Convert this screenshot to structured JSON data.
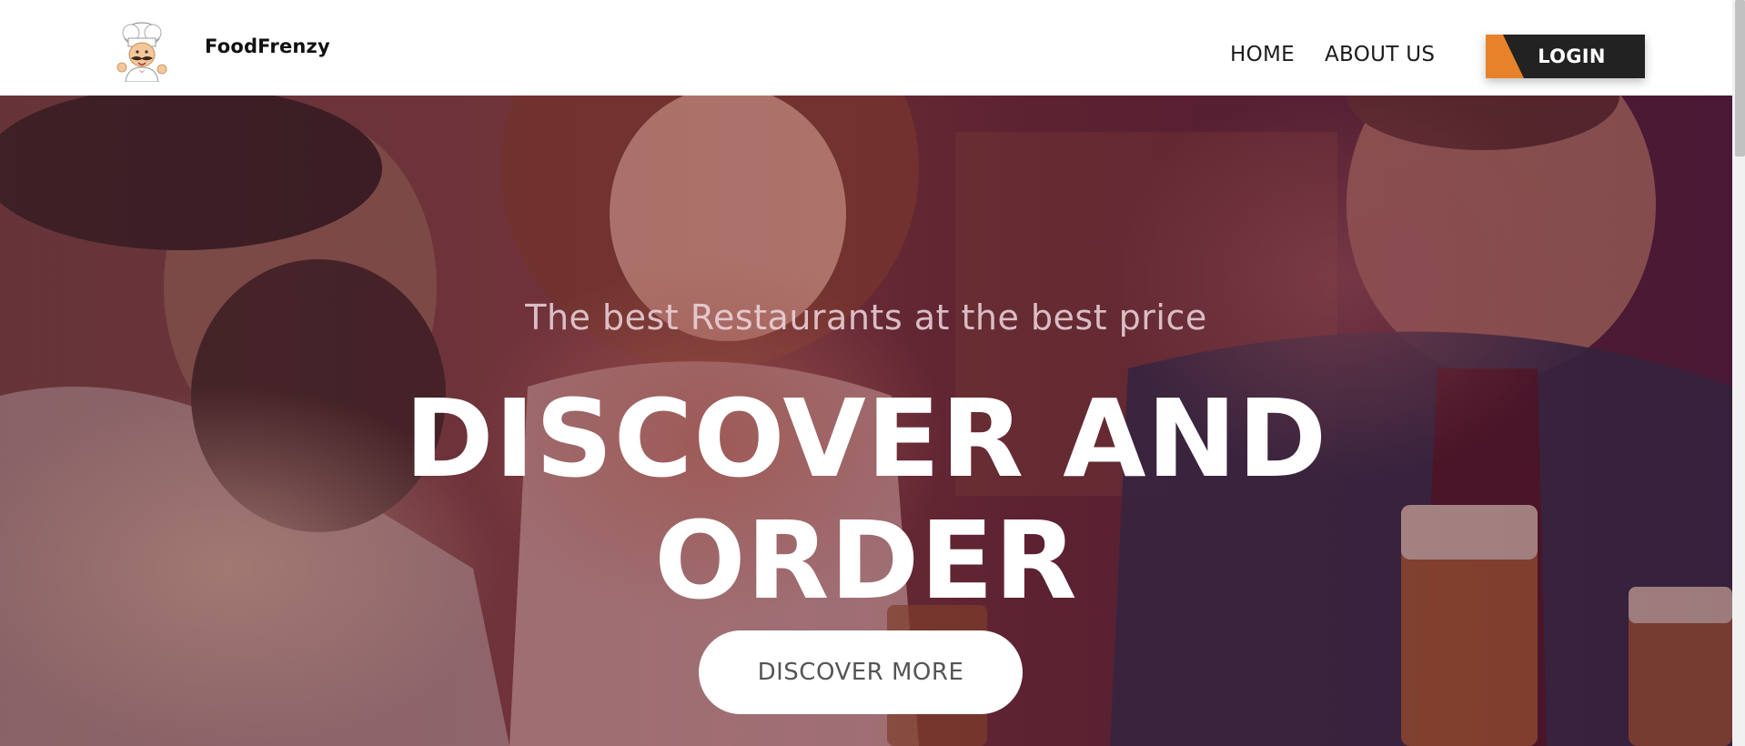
{
  "header": {
    "brand": "FoodFrenzy",
    "nav": {
      "home": "HOME",
      "about": "ABOUT US"
    },
    "login_label": "LOGIN"
  },
  "hero": {
    "tagline": "The best Restaurants at the best price",
    "headline_line1": "DISCOVER AND",
    "headline_line2": "ORDER",
    "cta_label": "DISCOVER MORE"
  },
  "colors": {
    "accent": "#e8822a",
    "login_bg": "#222222",
    "hero_tint": "#5c1830"
  },
  "icons": {
    "logo": "chef-logo-icon"
  }
}
